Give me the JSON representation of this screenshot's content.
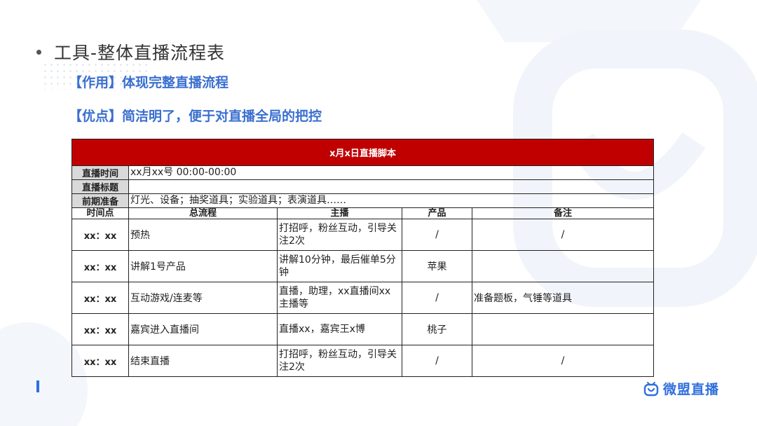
{
  "slide": {
    "title": "工具-整体直播流程表",
    "effect_line": "【作用】体现完整直播流程",
    "advantage_line": "【优点】简洁明了，便于对直播全局的把控"
  },
  "table": {
    "title": "x月x日直播脚本",
    "info": [
      {
        "label": "直播时间",
        "value": "xx月xx号 00:00-00:00"
      },
      {
        "label": "直播标题",
        "value": ""
      },
      {
        "label": "前期准备",
        "value": "灯光、设备；抽奖道具；实验道具；表演道具……"
      }
    ],
    "columns": [
      "时间点",
      "总流程",
      "主播",
      "产品",
      "备注"
    ],
    "rows": [
      {
        "time": "xx：xx",
        "flow": "预热",
        "host": "打招呼，粉丝互动，引导关注2次",
        "product": "/",
        "note": "/"
      },
      {
        "time": "xx：xx",
        "flow": "讲解1号产品",
        "host": "讲解10分钟，最后催单5分钟",
        "product": "苹果",
        "note": ""
      },
      {
        "time": "xx：xx",
        "flow": "互动游戏/连麦等",
        "host": "直播，助理，xx直播间xx主播等",
        "product": "/",
        "note": "准备题板，气锤等道具"
      },
      {
        "time": "xx：xx",
        "flow": "嘉宾进入直播间",
        "host": "直播xx，嘉宾王x博",
        "product": "桃子",
        "note": ""
      },
      {
        "time": "xx：xx",
        "flow": "结束直播",
        "host": "打招呼，粉丝互动，引导关注2次",
        "product": "/",
        "note": "/"
      }
    ]
  },
  "brand": {
    "logo_text": "微盟直播",
    "logo_icon": "tv-smile-icon",
    "accent_color": "#2f6fdd",
    "header_color": "#c00000"
  }
}
